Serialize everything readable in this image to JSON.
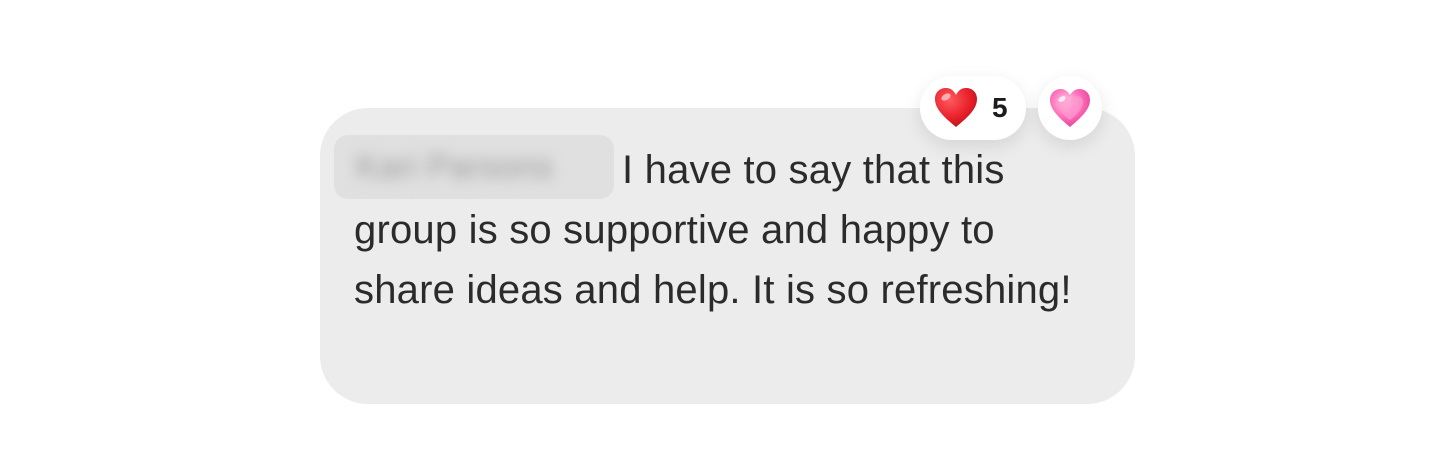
{
  "comment": {
    "author_name": "Kari Parsons",
    "author_blurred": true,
    "text": "I have to say that this group is so supportive and happy to share ideas and help. It is so refreshing!"
  },
  "reactions": [
    {
      "icon": "red-heart-icon",
      "color": "#e8202a",
      "count": "5"
    },
    {
      "icon": "sparkling-heart-icon",
      "color": "#f04fa0"
    }
  ],
  "colors": {
    "bubble": "#ececec",
    "text": "#2b2b2b",
    "pill": "#ffffff"
  }
}
